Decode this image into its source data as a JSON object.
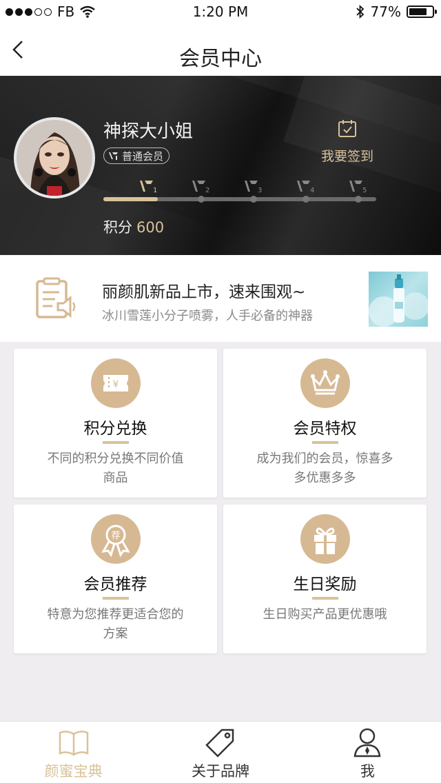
{
  "status_bar": {
    "carrier": "FB",
    "time": "1:20 PM",
    "battery_percent": "77%",
    "battery_level": 0.77
  },
  "nav": {
    "title": "会员中心",
    "back_icon": "chevron-left-icon"
  },
  "profile": {
    "name": "神探大小姐",
    "member_badge": "普通会员",
    "checkin_label": "我要签到",
    "points_label": "积分",
    "points_value": "600",
    "levels": [
      "1",
      "2",
      "3",
      "4",
      "5"
    ],
    "current_level": 1,
    "level_progress": 0.2
  },
  "banner": {
    "title": "丽颜肌新品上市，速来围观~",
    "subtitle": "冰川雪莲小分子喷雾，人手必备的神器"
  },
  "cards": [
    {
      "title": "积分兑换",
      "desc": "不同的积分兑换不同价值商品",
      "icon": "ticket-icon"
    },
    {
      "title": "会员特权",
      "desc": "成为我们的会员，惊喜多多优惠多多",
      "icon": "crown-icon"
    },
    {
      "title": "会员推荐",
      "desc": "特意为您推荐更适合您的方案",
      "icon": "ribbon-badge-icon"
    },
    {
      "title": "生日奖励",
      "desc": "生日购买产品更优惠哦",
      "icon": "gift-icon"
    }
  ],
  "tabs": [
    {
      "label": "颜蜜宝典",
      "icon": "book-icon",
      "active": true
    },
    {
      "label": "关于品牌",
      "icon": "tag-icon",
      "active": false
    },
    {
      "label": "我",
      "icon": "user-icon",
      "active": false
    }
  ],
  "colors": {
    "accent_gold": "#d9c29a",
    "icon_gold": "#d6b993",
    "hero_dark": "#1a1a1a"
  }
}
